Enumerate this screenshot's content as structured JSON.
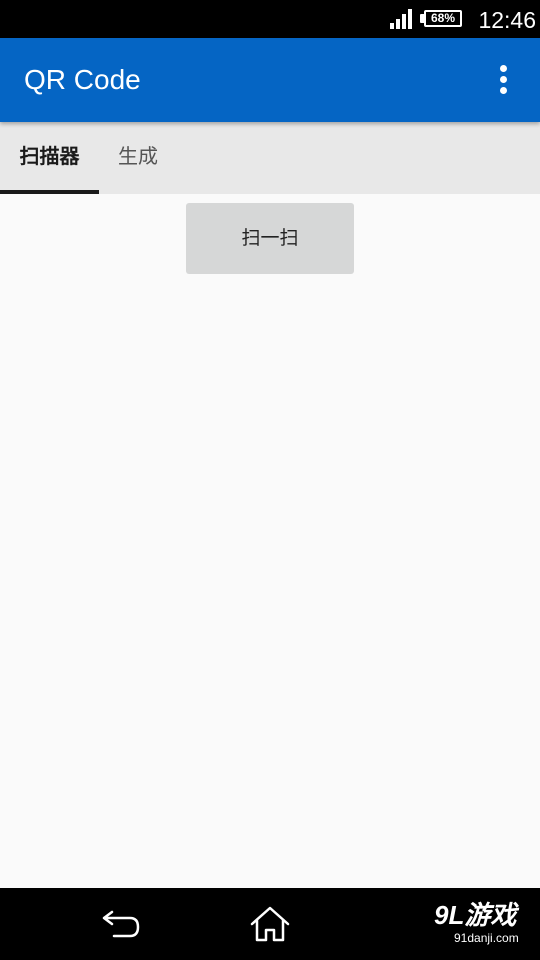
{
  "status_bar": {
    "battery_percent": "68%",
    "time": "12:46",
    "icons": [
      "signal-icon",
      "battery-icon"
    ]
  },
  "app_bar": {
    "title": "QR Code",
    "overflow_icon": "more-vert-icon"
  },
  "tabs": [
    {
      "label": "扫描器",
      "selected": true
    },
    {
      "label": "生成",
      "selected": false
    }
  ],
  "main": {
    "scan_button_label": "扫一扫"
  },
  "nav_bar": {
    "icons": [
      "back-icon",
      "home-icon"
    ]
  },
  "watermark": {
    "logo": "9L游戏",
    "url": "91danji.com"
  },
  "colors": {
    "app_bar": "#0565c4",
    "tab_bar": "#e8e8e8",
    "content_background": "#fafafa",
    "button": "#d6d7d7"
  }
}
